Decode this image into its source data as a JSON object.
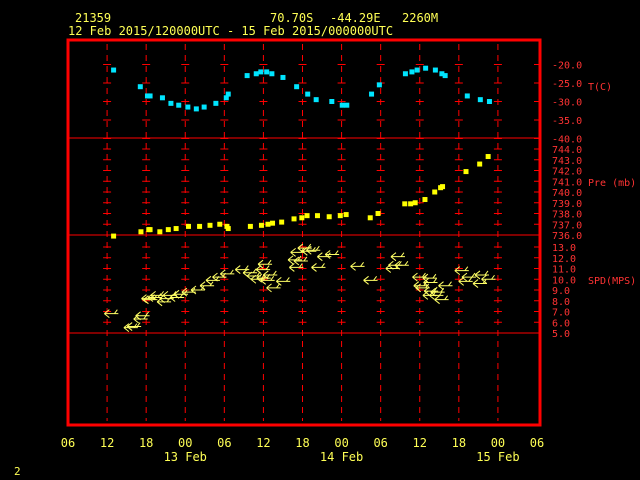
{
  "header": {
    "station_id": "21359",
    "latitude": "70.70S",
    "longitude": "-44.29E",
    "elevation": "2260M",
    "time_range": "12 Feb 2015/120000UTC - 15 Feb 2015/000000UTC"
  },
  "footer": {
    "page_number": "2"
  },
  "colors": {
    "background": "#000000",
    "frame": "#ff0000",
    "grid": "#ff0000",
    "axis_text": "#ffff55",
    "temperature": "#00e5ff",
    "pressure": "#ffff00",
    "wind": "#ffff66",
    "panel_label": "#ff3333"
  },
  "chart_data": {
    "type": "scatter",
    "x_unit": "hours since 12 Feb 2015 06 UTC",
    "xlim": [
      0,
      72
    ],
    "x_ticks": [
      {
        "x": 0,
        "label": "06"
      },
      {
        "x": 6,
        "label": "12"
      },
      {
        "x": 12,
        "label": "18"
      },
      {
        "x": 18,
        "label": "00"
      },
      {
        "x": 24,
        "label": "06"
      },
      {
        "x": 30,
        "label": "12"
      },
      {
        "x": 36,
        "label": "18"
      },
      {
        "x": 42,
        "label": "00"
      },
      {
        "x": 48,
        "label": "06"
      },
      {
        "x": 54,
        "label": "12"
      },
      {
        "x": 60,
        "label": "18"
      },
      {
        "x": 66,
        "label": "00"
      },
      {
        "x": 72,
        "label": "06"
      }
    ],
    "date_labels": [
      {
        "x": 18,
        "label": "13 Feb"
      },
      {
        "x": 42,
        "label": "14 Feb"
      },
      {
        "x": 66,
        "label": "15 Feb"
      }
    ],
    "panels": [
      {
        "name": "T(C)",
        "kind": "points",
        "ylim": [
          -40,
          -18
        ],
        "ticks": [
          "-20.0",
          "-25.0",
          "-30.0",
          "-35.0",
          "-40.0"
        ],
        "tick_values": [
          -20,
          -25,
          -30,
          -35,
          -40
        ],
        "points": [
          [
            7,
            -21.5
          ],
          [
            11.1,
            -26
          ],
          [
            12.2,
            -28.5
          ],
          [
            12.6,
            -28.5
          ],
          [
            14.5,
            -29
          ],
          [
            15.8,
            -30.5
          ],
          [
            17,
            -31
          ],
          [
            18.4,
            -31.5
          ],
          [
            19.7,
            -32
          ],
          [
            20.9,
            -31.5
          ],
          [
            22.7,
            -30.5
          ],
          [
            24.3,
            -29
          ],
          [
            24.6,
            -28
          ],
          [
            27.5,
            -23
          ],
          [
            28.9,
            -22.5
          ],
          [
            29.6,
            -22
          ],
          [
            30.5,
            -22
          ],
          [
            31.3,
            -22.5
          ],
          [
            33,
            -23.5
          ],
          [
            35.1,
            -26
          ],
          [
            36.8,
            -28
          ],
          [
            38.1,
            -29.5
          ],
          [
            40.5,
            -30
          ],
          [
            42.1,
            -31
          ],
          [
            42.8,
            -31
          ],
          [
            46.6,
            -28
          ],
          [
            47.8,
            -25.5
          ],
          [
            51.8,
            -22.5
          ],
          [
            52.8,
            -22
          ],
          [
            53.6,
            -21.5
          ],
          [
            54.9,
            -21
          ],
          [
            56.4,
            -21.5
          ],
          [
            57.4,
            -22.5
          ],
          [
            57.9,
            -23
          ],
          [
            61.3,
            -28.5
          ],
          [
            63.3,
            -29.5
          ],
          [
            64.7,
            -30
          ]
        ]
      },
      {
        "name": "Pre (mb)",
        "kind": "points",
        "ylim": [
          735.5,
          744.5
        ],
        "ticks": [
          "744.0",
          "743.0",
          "742.0",
          "741.0",
          "740.0",
          "739.0",
          "738.0",
          "737.0",
          "736.0"
        ],
        "tick_values": [
          744,
          743,
          742,
          741,
          740,
          739,
          738,
          737,
          736
        ],
        "points": [
          [
            7,
            735.9
          ],
          [
            11.2,
            736.3
          ],
          [
            12.4,
            736.5
          ],
          [
            12.6,
            736.5
          ],
          [
            14.1,
            736.3
          ],
          [
            15.4,
            736.5
          ],
          [
            16.6,
            736.6
          ],
          [
            18.5,
            736.8
          ],
          [
            20.2,
            736.8
          ],
          [
            21.8,
            736.9
          ],
          [
            23.3,
            737
          ],
          [
            24.4,
            736.8
          ],
          [
            24.6,
            736.6
          ],
          [
            28,
            736.8
          ],
          [
            29.7,
            736.9
          ],
          [
            30.7,
            737
          ],
          [
            31.4,
            737.1
          ],
          [
            32.8,
            737.2
          ],
          [
            34.7,
            737.5
          ],
          [
            35.9,
            737.6
          ],
          [
            36.7,
            737.8
          ],
          [
            38.3,
            737.8
          ],
          [
            40.1,
            737.7
          ],
          [
            41.8,
            737.8
          ],
          [
            42.7,
            737.9
          ],
          [
            46.4,
            737.6
          ],
          [
            47.6,
            738
          ],
          [
            51.7,
            738.9
          ],
          [
            52.6,
            738.9
          ],
          [
            53.3,
            739
          ],
          [
            54.8,
            739.3
          ],
          [
            56.3,
            740
          ],
          [
            57.2,
            740.4
          ],
          [
            57.5,
            740.5
          ],
          [
            61.1,
            741.9
          ],
          [
            63.2,
            742.6
          ],
          [
            64.5,
            743.3
          ]
        ]
      },
      {
        "name": "SPD(MPS)",
        "kind": "wind_barbs",
        "ylim": [
          4.5,
          13.5
        ],
        "ticks": [
          "13.0",
          "12.0",
          "11.0",
          "10.0",
          "9.0",
          "8.0",
          "7.0",
          "6.0",
          "5.0"
        ],
        "tick_values": [
          13,
          12,
          11,
          10,
          9,
          8,
          7,
          6,
          5
        ],
        "barbs": [
          [
            6.5,
            6.8
          ],
          [
            9.5,
            5.5
          ],
          [
            10,
            5.6
          ],
          [
            11,
            6.3
          ],
          [
            11.3,
            6.6
          ],
          [
            12.2,
            8.2
          ],
          [
            12.5,
            8.1
          ],
          [
            13.2,
            8.3
          ],
          [
            13.6,
            8.5
          ],
          [
            14.6,
            7.9
          ],
          [
            15,
            8.2
          ],
          [
            15.5,
            8.5
          ],
          [
            16.6,
            8.3
          ],
          [
            17.2,
            8.6
          ],
          [
            18.4,
            8.8
          ],
          [
            19.8,
            9
          ],
          [
            21.2,
            9.4
          ],
          [
            22.1,
            9.9
          ],
          [
            23.1,
            10.2
          ],
          [
            24.3,
            10.5
          ],
          [
            26.6,
            10.9
          ],
          [
            27.8,
            10.6
          ],
          [
            28.4,
            10.3
          ],
          [
            29,
            10
          ],
          [
            29.8,
            10.9
          ],
          [
            29.9,
            10.1
          ],
          [
            30.1,
            11.4
          ],
          [
            30.5,
            9.9
          ],
          [
            30.9,
            10.4
          ],
          [
            31.4,
            9.2
          ],
          [
            32.9,
            9.8
          ],
          [
            34.7,
            11.8
          ],
          [
            34.9,
            11.1
          ],
          [
            35.1,
            12.5
          ],
          [
            35.6,
            11.7
          ],
          [
            36.2,
            12.9
          ],
          [
            36.9,
            12.6
          ],
          [
            37.5,
            12.7
          ],
          [
            38.3,
            11.1
          ],
          [
            39.2,
            12.1
          ],
          [
            40.4,
            12.3
          ],
          [
            44.3,
            11.2
          ],
          [
            46.3,
            9.9
          ],
          [
            49.7,
            11
          ],
          [
            50.1,
            11.3
          ],
          [
            50.5,
            12.1
          ],
          [
            51.1,
            11.3
          ],
          [
            53.8,
            10.2
          ],
          [
            54,
            9.4
          ],
          [
            54.3,
            9.2
          ],
          [
            55.4,
            10.1
          ],
          [
            55.4,
            8.5
          ],
          [
            55.5,
            9.7
          ],
          [
            55.6,
            8.9
          ],
          [
            56.4,
            8.5
          ],
          [
            56.6,
            8.8
          ],
          [
            57.2,
            8.1
          ],
          [
            57.8,
            9.4
          ],
          [
            60.3,
            10.8
          ],
          [
            60.9,
            9.8
          ],
          [
            61.4,
            10.2
          ],
          [
            63.1,
            9.6
          ],
          [
            63.4,
            10.4
          ],
          [
            64.4,
            10
          ]
        ]
      }
    ]
  }
}
